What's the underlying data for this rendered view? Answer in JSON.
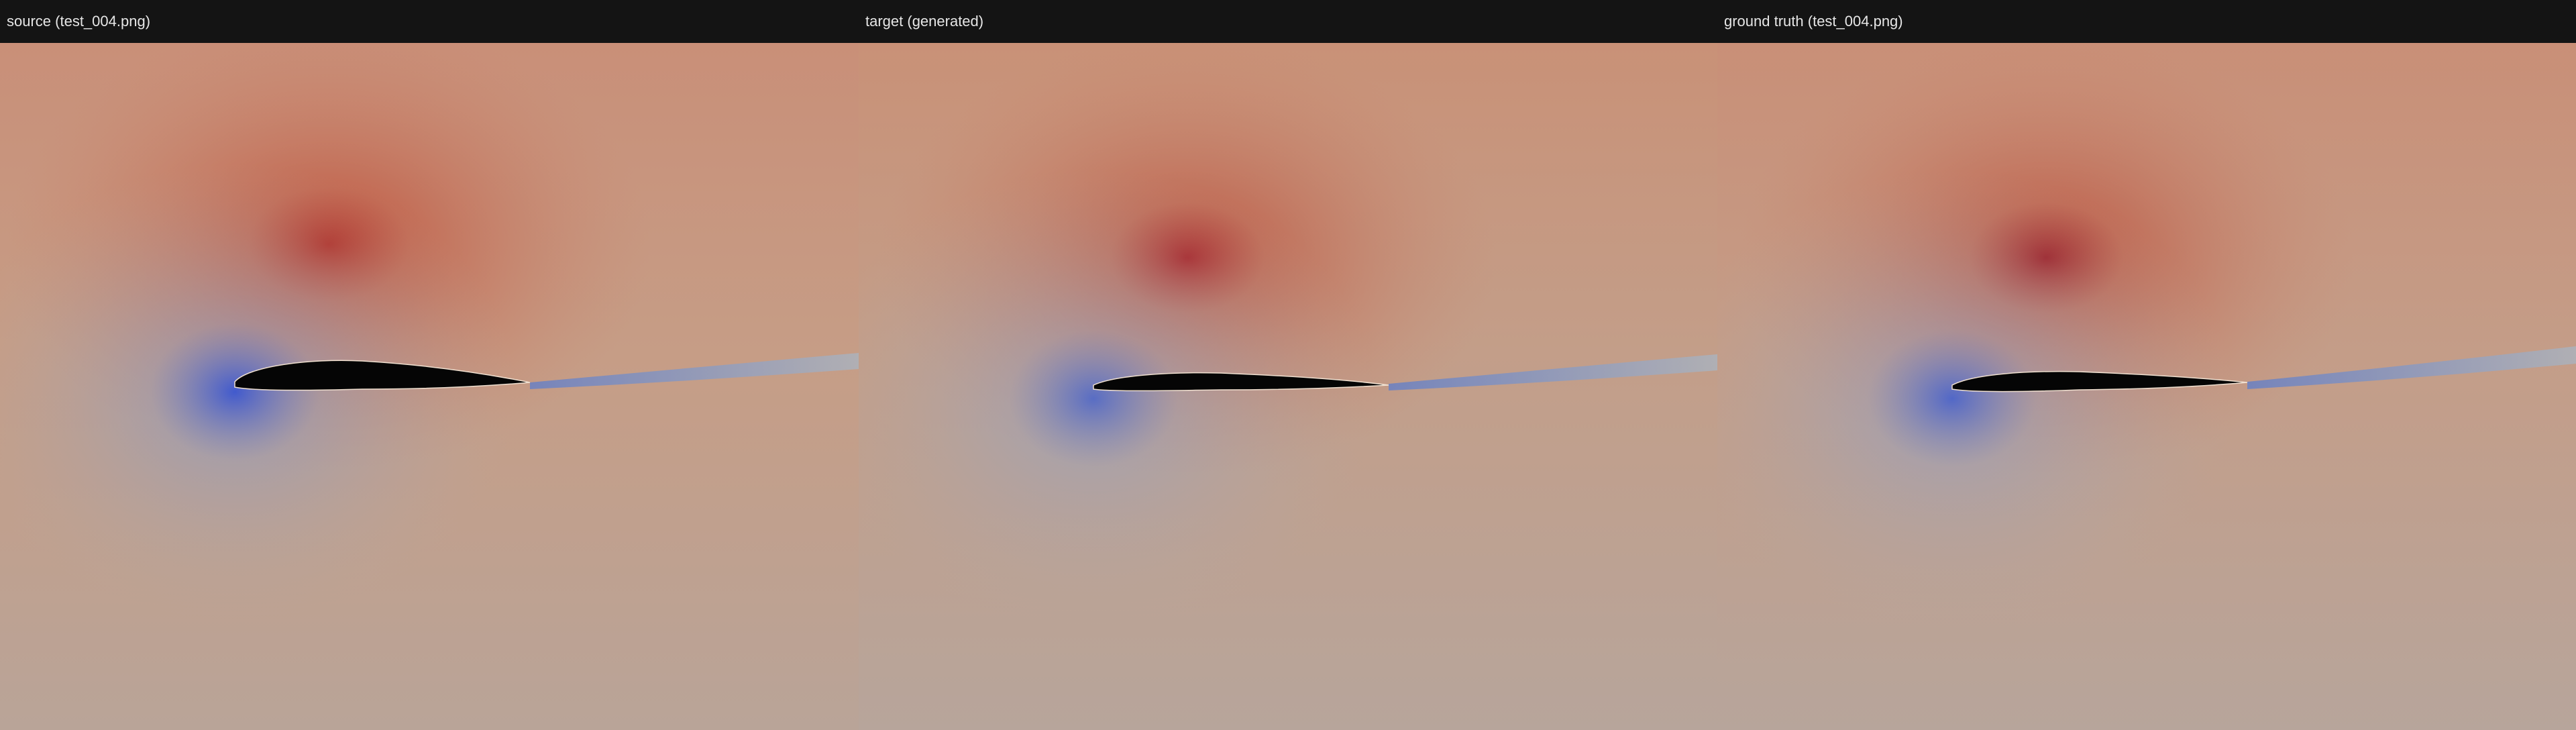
{
  "panels": [
    {
      "title": "source (test_004.png)"
    },
    {
      "title": "target (generated)"
    },
    {
      "title": "ground truth (test_004.png)"
    }
  ],
  "colors": {
    "header_background": "#141414",
    "header_text": "#e6e6e6",
    "field_upper": "#c98b72",
    "field_background": "#c4a08a",
    "field_lower": "#b4a59a",
    "high_pressure": "#b01818",
    "low_pressure": "#3a5ccc",
    "airfoil": "#050505",
    "wake": "#9fb2c6"
  }
}
